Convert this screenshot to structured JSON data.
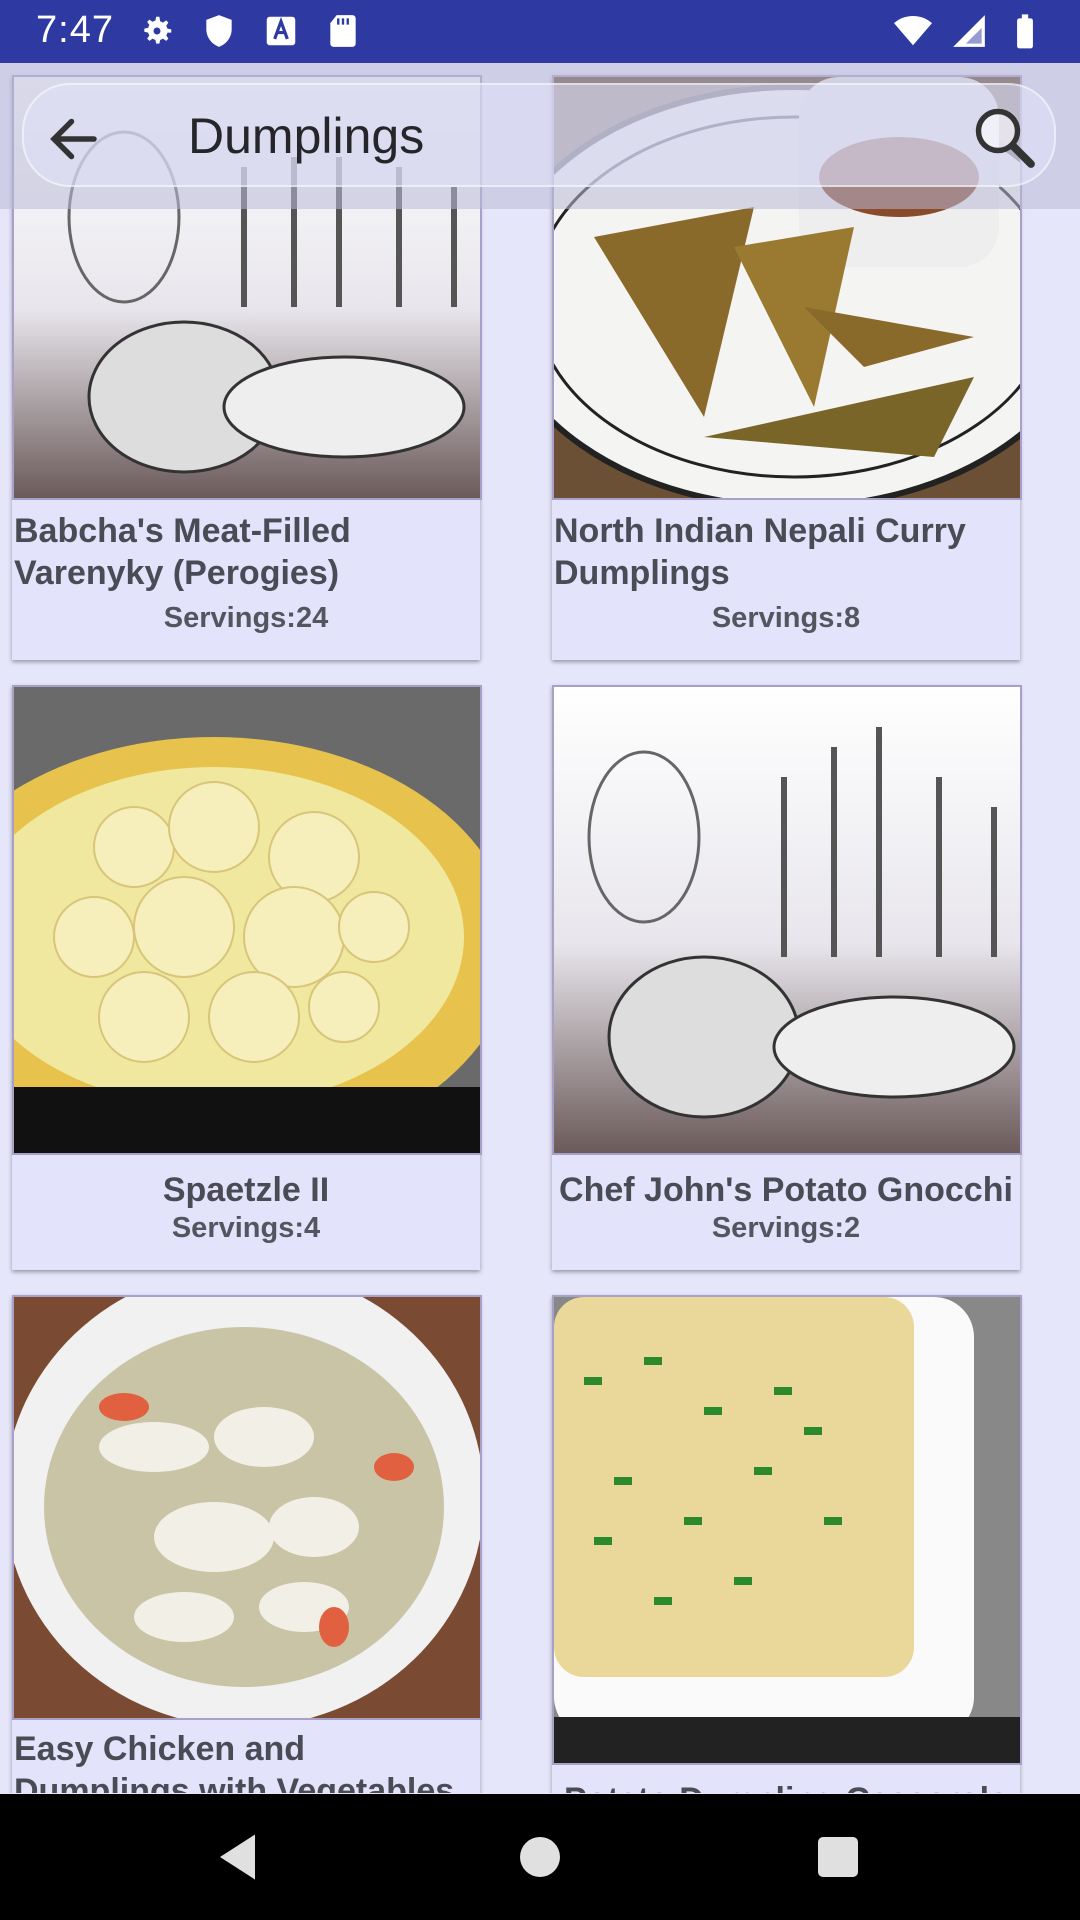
{
  "status_bar": {
    "time": "7:47",
    "left_icons": [
      "settings-icon",
      "shield-icon",
      "a-icon",
      "sdcard-icon"
    ],
    "right_icons": [
      "wifi-icon",
      "signal-icon",
      "battery-icon"
    ]
  },
  "toolbar": {
    "title": "Dumplings",
    "back_icon": "arrow-back-icon",
    "search_icon": "search-icon"
  },
  "recipes": [
    {
      "title": "Babcha's Meat-Filled Varenyky (Perogies)",
      "servings": "Servings:24",
      "image": "tableware-placeholder"
    },
    {
      "title": "North Indian Nepali Curry Dumplings",
      "servings": "Servings:8",
      "image": "fried-dumplings-photo"
    },
    {
      "title": "Spaetzle II",
      "servings": "Servings:4",
      "image": "spaetzle-photo"
    },
    {
      "title": "Chef John's Potato Gnocchi",
      "servings": "Servings:2",
      "image": "tableware-placeholder"
    },
    {
      "title": "Easy Chicken and Dumplings with Vegetables",
      "servings": "",
      "image": "chicken-soup-photo"
    },
    {
      "title": "Potato Dumpling Casserole",
      "servings": "",
      "image": "casserole-photo"
    }
  ],
  "nav_bar": {
    "back": "nav-back-icon",
    "home": "nav-home-icon",
    "recents": "nav-recents-icon"
  },
  "colors": {
    "status_bar": "#2e3aa2",
    "background": "#e6e6fb",
    "card": "#e3e3fb",
    "title_text": "#4b4b55"
  }
}
